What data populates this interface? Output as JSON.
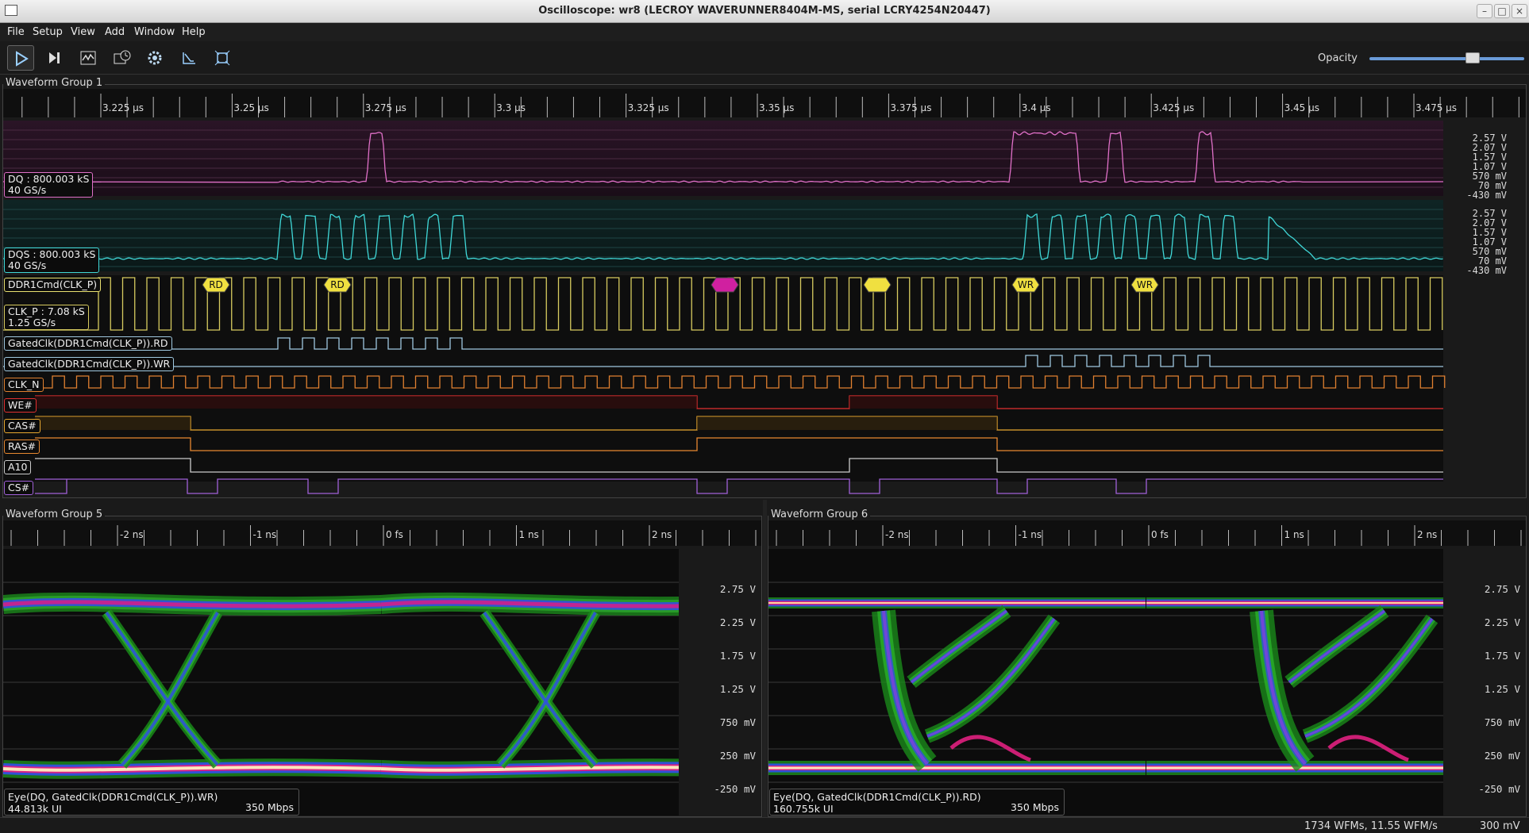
{
  "window": {
    "title": "Oscilloscope: wr8 (LECROY WAVERUNNER8404M-MS, serial LCRY4254N20447)"
  },
  "menu": [
    "File",
    "Setup",
    "View",
    "Add",
    "Window",
    "Help"
  ],
  "toolbar": {
    "buttons": [
      "play-icon",
      "step-icon",
      "waveform-icon",
      "history-icon",
      "settings-icon",
      "measure-icon",
      "fullscreen-icon"
    ],
    "opacity_label": "Opacity",
    "opacity_value": 0.6
  },
  "group1": {
    "title": "Waveform Group 1",
    "time_ticks": [
      "3.225 µs",
      "3.25 µs",
      "3.275 µs",
      "3.3 µs",
      "3.325 µs",
      "3.35 µs",
      "3.375 µs",
      "3.4 µs",
      "3.425 µs",
      "3.45 µs",
      "3.475 µs"
    ],
    "dq": {
      "name": "DQ : 800.003 kS",
      "rate": "40 GS/s",
      "color": "#e070c8",
      "volts": [
        "2.57 V",
        "2.07 V",
        "1.57 V",
        "1.07 V",
        "570 mV",
        "70 mV",
        "-430 mV"
      ]
    },
    "dqs": {
      "name": "DQS : 800.003 kS",
      "rate": "40 GS/s",
      "color": "#40d8d8",
      "volts": [
        "2.57 V",
        "2.07 V",
        "1.57 V",
        "1.07 V",
        "570 mV",
        "70 mV",
        "-430 mV"
      ]
    },
    "cmd": {
      "name": "DDR1Cmd(CLK_P)",
      "color": "#e8e070",
      "packets": [
        {
          "label": "RD",
          "color": "#f0e040"
        },
        {
          "label": "RD",
          "color": "#f0e040"
        },
        {
          "label": "",
          "color": "#d020a0"
        },
        {
          "label": "",
          "color": "#f0e040"
        },
        {
          "label": "WR",
          "color": "#f0e040"
        },
        {
          "label": "WR",
          "color": "#f0e040"
        }
      ]
    },
    "clkp": {
      "name": "CLK_P : 7.08 kS",
      "rate": "1.25 GS/s",
      "color": "#d8cc60"
    },
    "gated_rd": {
      "name": "GatedClk(DDR1Cmd(CLK_P)).RD",
      "color": "#a0c8e0"
    },
    "gated_wr": {
      "name": "GatedClk(DDR1Cmd(CLK_P)).WR",
      "color": "#a0c8e0"
    },
    "clkn": {
      "name": "CLK_N",
      "color": "#e08030"
    },
    "we": {
      "name": "WE#",
      "color": "#e03030"
    },
    "cas": {
      "name": "CAS#",
      "color": "#e8a830"
    },
    "ras": {
      "name": "RAS#",
      "color": "#e88830"
    },
    "a10": {
      "name": "A10",
      "color": "#cccccc"
    },
    "cs": {
      "name": "CS#",
      "color": "#a060d8"
    }
  },
  "group5": {
    "title": "Waveform Group 5",
    "time_ticks": [
      "-2 ns",
      "-1 ns",
      "0 fs",
      "1 ns",
      "2 ns"
    ],
    "volts": [
      "2.75 V",
      "2.25 V",
      "1.75 V",
      "1.25 V",
      "750 mV",
      "250 mV",
      "-250 mV"
    ],
    "eye_name": "Eye(DQ, GatedClk(DDR1Cmd(CLK_P)).WR)",
    "eye_ui": "44.813k UI",
    "eye_rate": "350 Mbps"
  },
  "group6": {
    "title": "Waveform Group 6",
    "time_ticks": [
      "-2 ns",
      "-1 ns",
      "0 fs",
      "1 ns",
      "2 ns"
    ],
    "volts": [
      "2.75 V",
      "2.25 V",
      "1.75 V",
      "1.25 V",
      "750 mV",
      "250 mV",
      "-250 mV"
    ],
    "eye_name": "Eye(DQ, GatedClk(DDR1Cmd(CLK_P)).RD)",
    "eye_ui": "160.755k UI",
    "eye_rate": "350 Mbps"
  },
  "status": {
    "wfms": "1734 WFMs, 11.55 WFM/s",
    "mem": "300 mV"
  }
}
